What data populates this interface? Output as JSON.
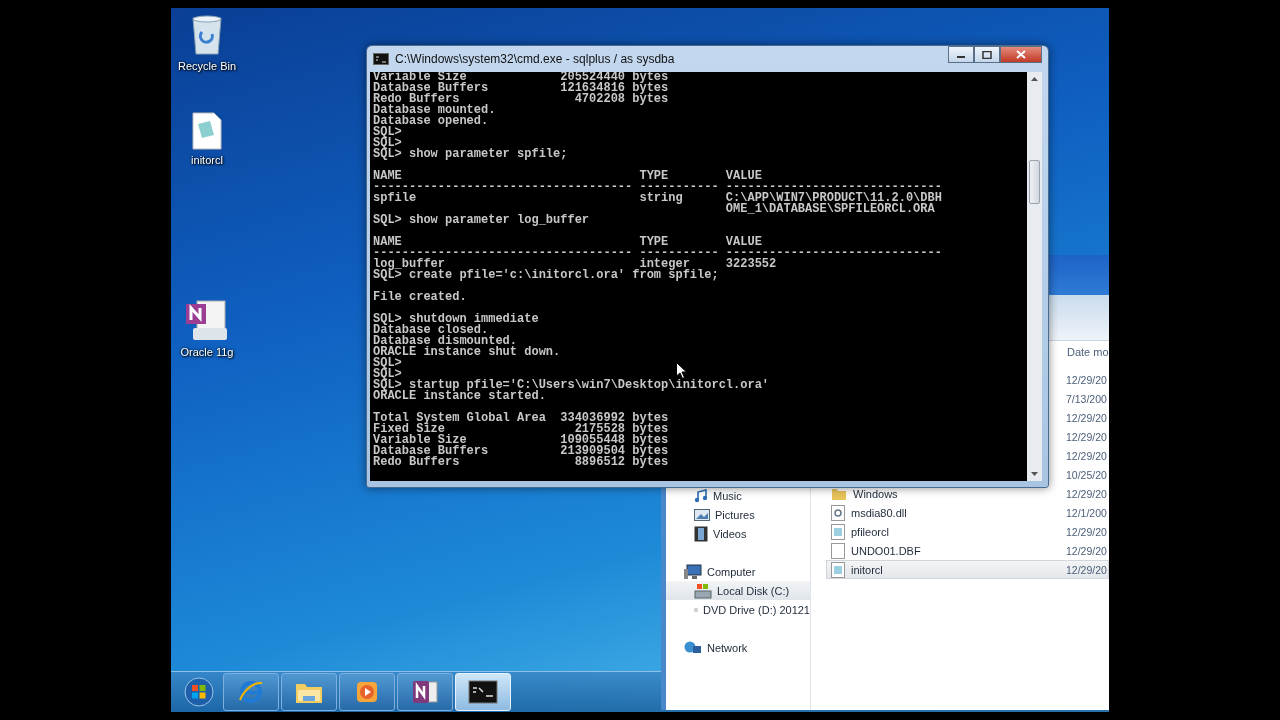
{
  "desktop_icons": [
    {
      "label": "Recycle Bin",
      "kind": "recycle"
    },
    {
      "label": "initorcl",
      "kind": "notepad"
    },
    {
      "label": "Oracle 11g",
      "kind": "onenote"
    }
  ],
  "console_window": {
    "title": "C:\\Windows\\system32\\cmd.exe - sqlplus  / as sysdba",
    "blocks": [
      [
        "Variable Size             205524440 bytes",
        "Database Buffers          121634816 bytes",
        "Redo Buffers                4702208 bytes",
        "Database mounted.",
        "Database opened.",
        "SQL>",
        "SQL>",
        "SQL> show parameter spfile;"
      ],
      [
        "NAME                                 TYPE        VALUE",
        "------------------------------------ ----------- ------------------------------",
        "spfile                               string      C:\\APP\\WIN7\\PRODUCT\\11.2.0\\DBH",
        "                                                 OME_1\\DATABASE\\SPFILEORCL.ORA",
        "SQL> show parameter log_buffer"
      ],
      [
        "NAME                                 TYPE        VALUE",
        "------------------------------------ ----------- ------------------------------",
        "log_buffer                           integer     3223552",
        "SQL> create pfile='c:\\initorcl.ora' from spfile;"
      ],
      [
        "File created."
      ],
      [
        "SQL> shutdown immediate",
        "Database closed.",
        "Database dismounted.",
        "ORACLE instance shut down.",
        "SQL>",
        "SQL>",
        "SQL> startup pfile='C:\\Users\\win7\\Desktop\\initorcl.ora'",
        "ORACLE instance started."
      ],
      [
        "Total System Global Area  334036992 bytes",
        "Fixed Size                  2175528 bytes",
        "Variable Size             109055448 bytes",
        "Database Buffers          213909504 bytes",
        "Redo Buffers                8896512 bytes"
      ]
    ]
  },
  "explorer": {
    "column_header": "Date mo",
    "library_items": [
      {
        "label": "Music",
        "kind": "music",
        "selected": false
      },
      {
        "label": "Pictures",
        "kind": "pictures",
        "selected": false
      },
      {
        "label": "Videos",
        "kind": "videos",
        "selected": false
      }
    ],
    "tree": [
      {
        "label": "Computer",
        "kind": "computer",
        "selected": false,
        "children": [
          {
            "label": "Local Disk (C:)",
            "kind": "disk",
            "selected": true
          },
          {
            "label": "DVD Drive (D:) 20121",
            "kind": "dvd",
            "selected": false
          }
        ]
      },
      {
        "label": "Network",
        "kind": "network",
        "selected": false
      }
    ],
    "rows": [
      {
        "date": "12/29/20",
        "selected": false
      },
      {
        "date": "7/13/200",
        "selected": false
      },
      {
        "date": "12/29/20",
        "selected": false
      },
      {
        "date": "12/29/20",
        "selected": false
      },
      {
        "date": "12/29/20",
        "selected": false
      },
      {
        "date": "10/25/20",
        "selected": false
      },
      {
        "name": "Windows",
        "kind": "folder",
        "date": "12/29/20",
        "selected": false
      },
      {
        "name": "msdia80.dll",
        "kind": "dll",
        "date": "12/1/200",
        "selected": false
      },
      {
        "name": "pfileorcl",
        "kind": "text",
        "date": "12/29/20",
        "selected": false
      },
      {
        "name": "UNDO01.DBF",
        "kind": "blank",
        "date": "12/29/20",
        "selected": false
      },
      {
        "name": "initorcl",
        "kind": "text",
        "date": "12/29/20",
        "selected": true
      }
    ]
  },
  "taskbar": [
    {
      "kind": "ie",
      "active": false
    },
    {
      "kind": "explorer",
      "active": false
    },
    {
      "kind": "media",
      "active": false
    },
    {
      "kind": "onenote",
      "active": false
    },
    {
      "kind": "cmd",
      "active": true
    }
  ]
}
